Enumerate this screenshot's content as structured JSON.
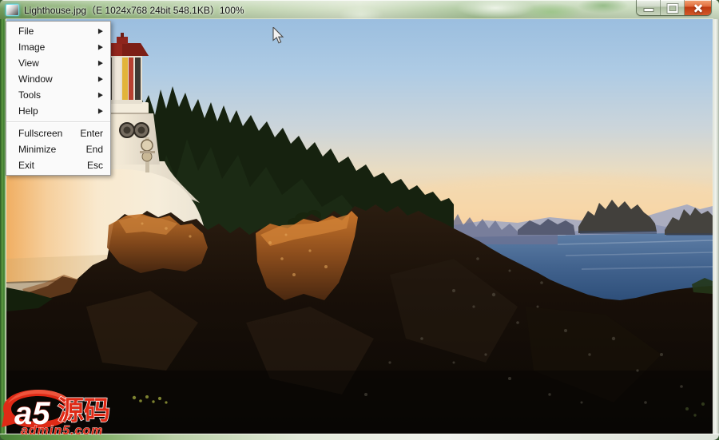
{
  "window": {
    "title": "Lighthouse.jpg（E 1024x768 24bit 548.1KB）100%"
  },
  "menu": {
    "submenu_arrow": "▶",
    "items": [
      {
        "label": "File"
      },
      {
        "label": "Image"
      },
      {
        "label": "View"
      },
      {
        "label": "Window"
      },
      {
        "label": "Tools"
      },
      {
        "label": "Help"
      }
    ],
    "commands": [
      {
        "label": "Fullscreen",
        "shortcut": "Enter"
      },
      {
        "label": "Minimize",
        "shortcut": "End"
      },
      {
        "label": "Exit",
        "shortcut": "Esc"
      }
    ]
  },
  "watermark": {
    "brand": "a5",
    "brand_cn": "源码",
    "domain": "admin5.com"
  },
  "colors": {
    "titlebar_green": "#93b87c",
    "close_button_red": "#c23c12",
    "menu_bg": "#fafafa",
    "watermark_red": "#df2a16",
    "sky_top": "#9bbedf",
    "sunset_peach": "#f2c79c",
    "ocean_blue": "#3f618c",
    "rock_dark": "#16100a",
    "rock_lit": "#b06a30",
    "lighthouse_white": "#f5ecd9",
    "roof_red": "#93271d",
    "tree_dark": "#16220f"
  }
}
